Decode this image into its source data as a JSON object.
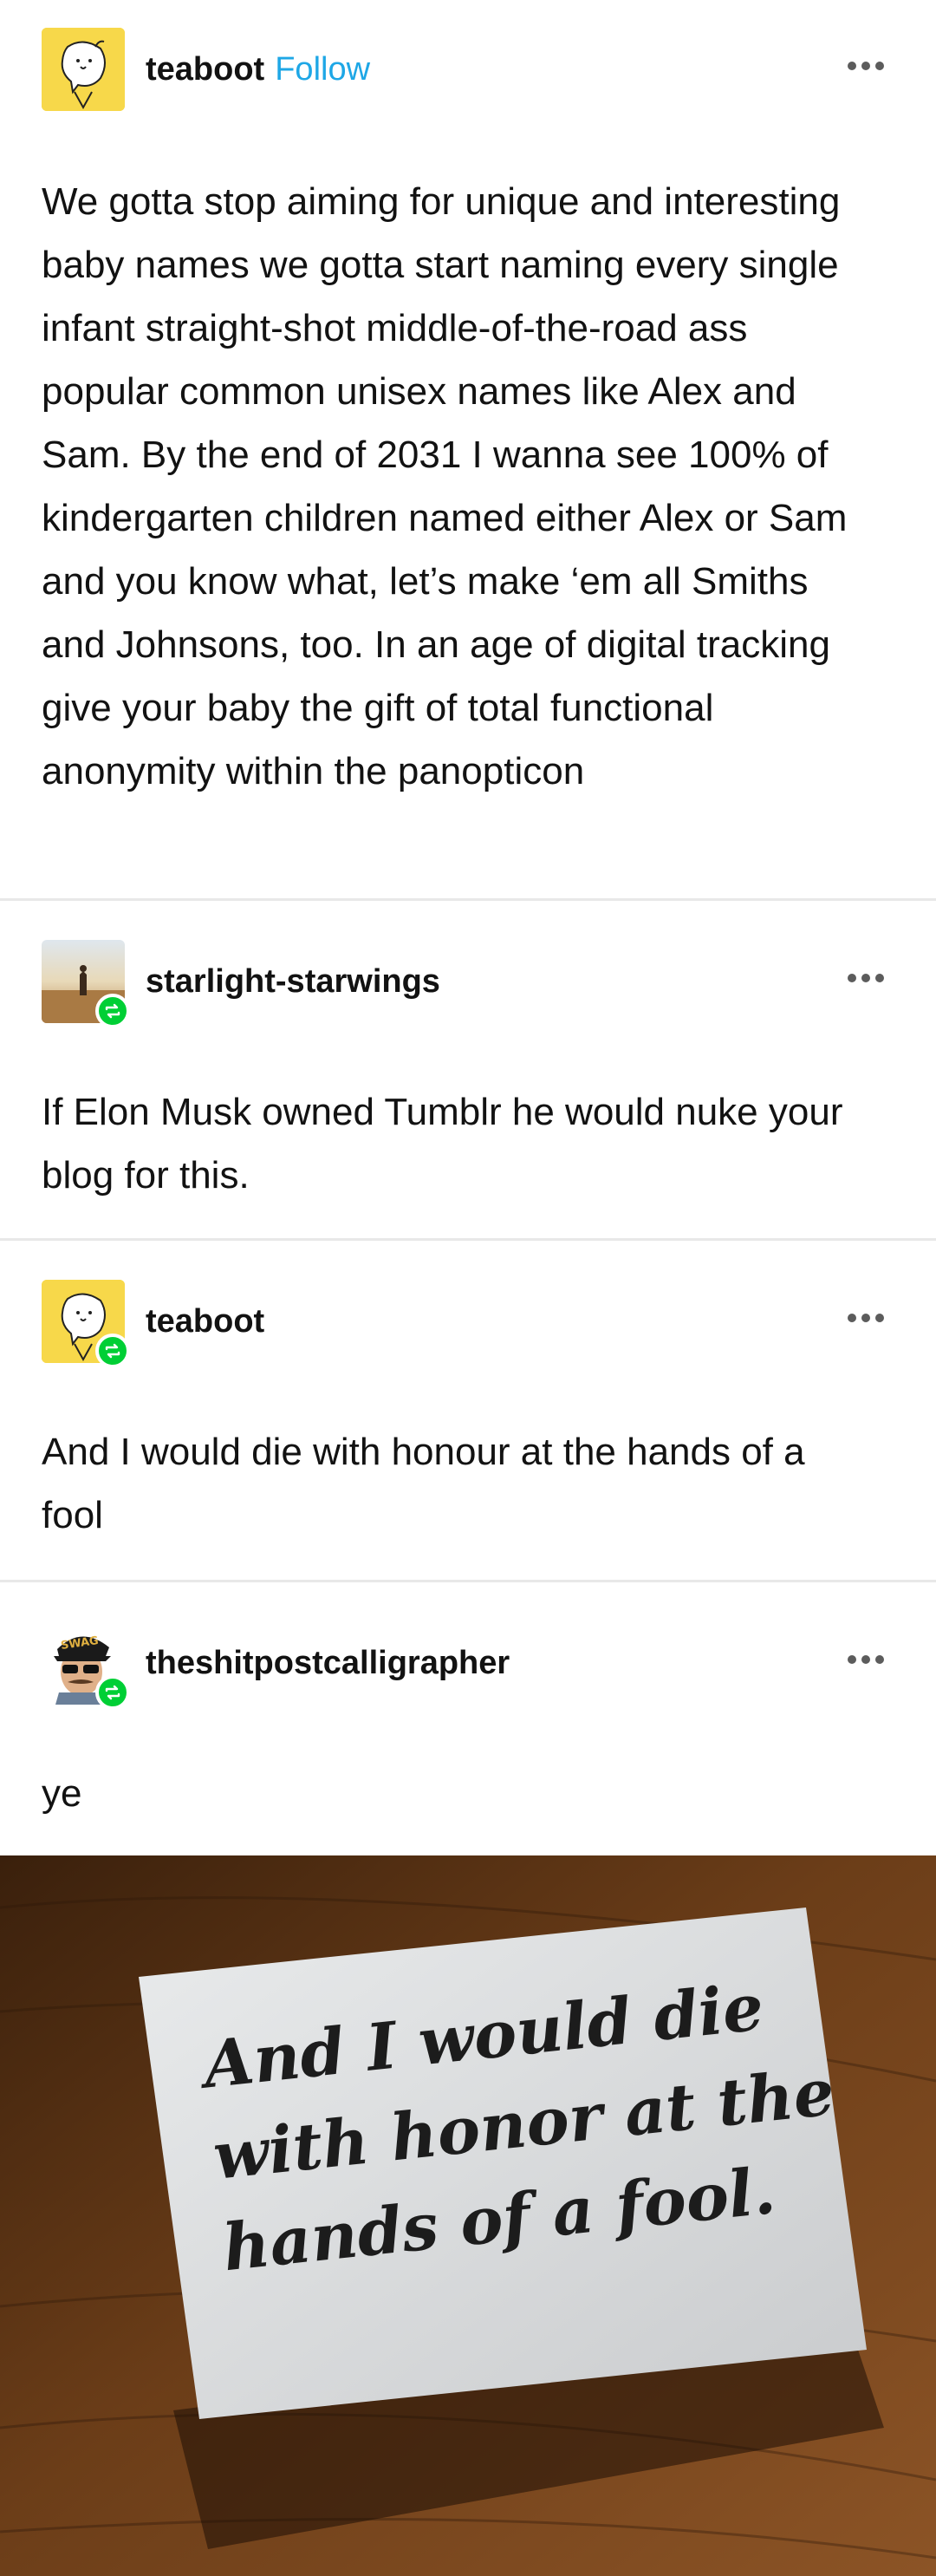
{
  "posts": [
    {
      "username": "teaboot",
      "follow_label": "Follow",
      "text": "We gotta stop aiming for unique and interesting baby names we gotta start naming every single infant straight-shot middle-of-the-road ass popular common unisex names like Alex and Sam. By the end of 2031 I wanna see 100% of kindergarten children named either Alex or Sam and you know what, let’s make ‘em all Smiths and Johnsons, too. In an age of digital tracking give your baby the gift of total functional anonymity within the panopticon"
    },
    {
      "username": "starlight-starwings",
      "text": "If Elon Musk owned Tumblr he would nuke your blog for this."
    },
    {
      "username": "teaboot",
      "text": "And I would die with honour at the hands of a fool"
    },
    {
      "username": "theshitpostcalligrapher",
      "text": "ye",
      "avatar_cap_text": "SWAG"
    }
  ],
  "photo": {
    "card_text_lines": [
      "And I would die",
      "with honor at the",
      "hands of a fool."
    ]
  },
  "colors": {
    "follow": "#1ea7e6",
    "reblog_badge": "#00cf35",
    "divider": "#e8e8e8"
  },
  "icons": [
    "teaboot-avatar",
    "starlight-avatar",
    "calligrapher-avatar",
    "more-options-icon",
    "reblog-icon"
  ]
}
